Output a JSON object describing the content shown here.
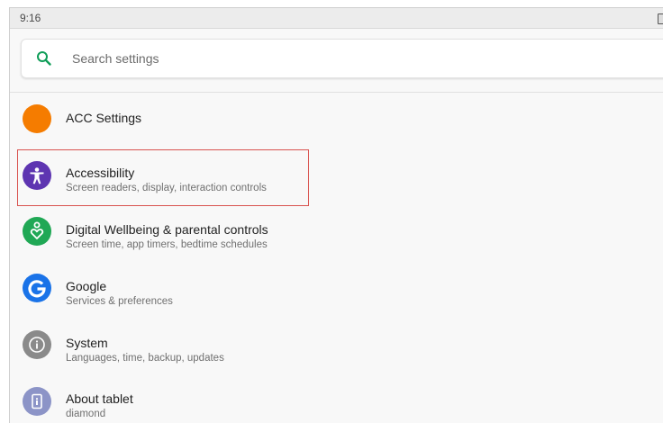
{
  "status_bar": {
    "time": "9:16"
  },
  "search": {
    "placeholder": "Search settings"
  },
  "colors": {
    "accent": "#0f9d58",
    "acc_orange": "#f57c00",
    "accessibility_purple": "#5e35b1",
    "wellbeing_green": "#20a855",
    "google_blue": "#1a73e8",
    "system_gray": "#8a8a8a",
    "about_lavender": "#8c94c7",
    "highlight_red": "#d9534f"
  },
  "settings": [
    {
      "title": "ACC Settings",
      "subtitle": "",
      "icon": "orange-circle-icon"
    },
    {
      "title": "Accessibility",
      "subtitle": "Screen readers, display, interaction controls",
      "icon": "accessibility-icon"
    },
    {
      "title": "Digital Wellbeing & parental controls",
      "subtitle": "Screen time, app timers, bedtime schedules",
      "icon": "digital-wellbeing-icon"
    },
    {
      "title": "Google",
      "subtitle": "Services & preferences",
      "icon": "google-icon"
    },
    {
      "title": "System",
      "subtitle": "Languages, time, backup, updates",
      "icon": "system-info-icon"
    },
    {
      "title": "About tablet",
      "subtitle": "diamond",
      "icon": "tablet-icon"
    }
  ]
}
